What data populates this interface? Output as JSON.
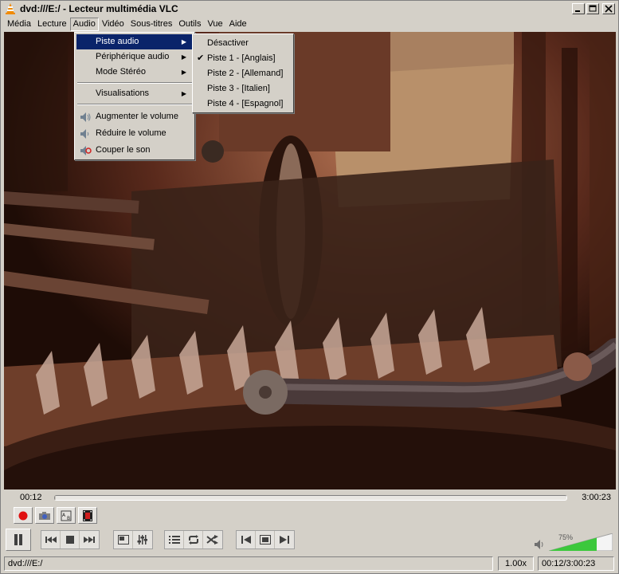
{
  "window": {
    "title": "dvd:///E:/ - Lecteur multimédia VLC"
  },
  "menubar": [
    "Média",
    "Lecture",
    "Audio",
    "Vidéo",
    "Sous-titres",
    "Outils",
    "Vue",
    "Aide"
  ],
  "audio_menu": {
    "items": [
      "Piste audio",
      "Périphérique audio",
      "Mode Stéréo",
      "Visualisations",
      "Augmenter le volume",
      "Réduire le volume",
      "Couper le son"
    ]
  },
  "track_menu": {
    "items": [
      "Désactiver",
      "Piste 1 - [Anglais]",
      "Piste 2 - [Allemand]",
      "Piste 3 - [Italien]",
      "Piste 4 - [Espagnol]"
    ],
    "checked": "Piste 1 - [Anglais]"
  },
  "playback": {
    "elapsed": "00:12",
    "total": "3:00:23",
    "progress": 0.0011
  },
  "volume": {
    "label": "75%",
    "level": 0.75
  },
  "status": {
    "media": "dvd:///E:/",
    "speed": "1.00x",
    "time": "00:12/3:00:23"
  },
  "colors": {
    "menu_highlight": "#0a246a",
    "volume_fill": "#3cc83c",
    "record_red": "#e01010"
  }
}
